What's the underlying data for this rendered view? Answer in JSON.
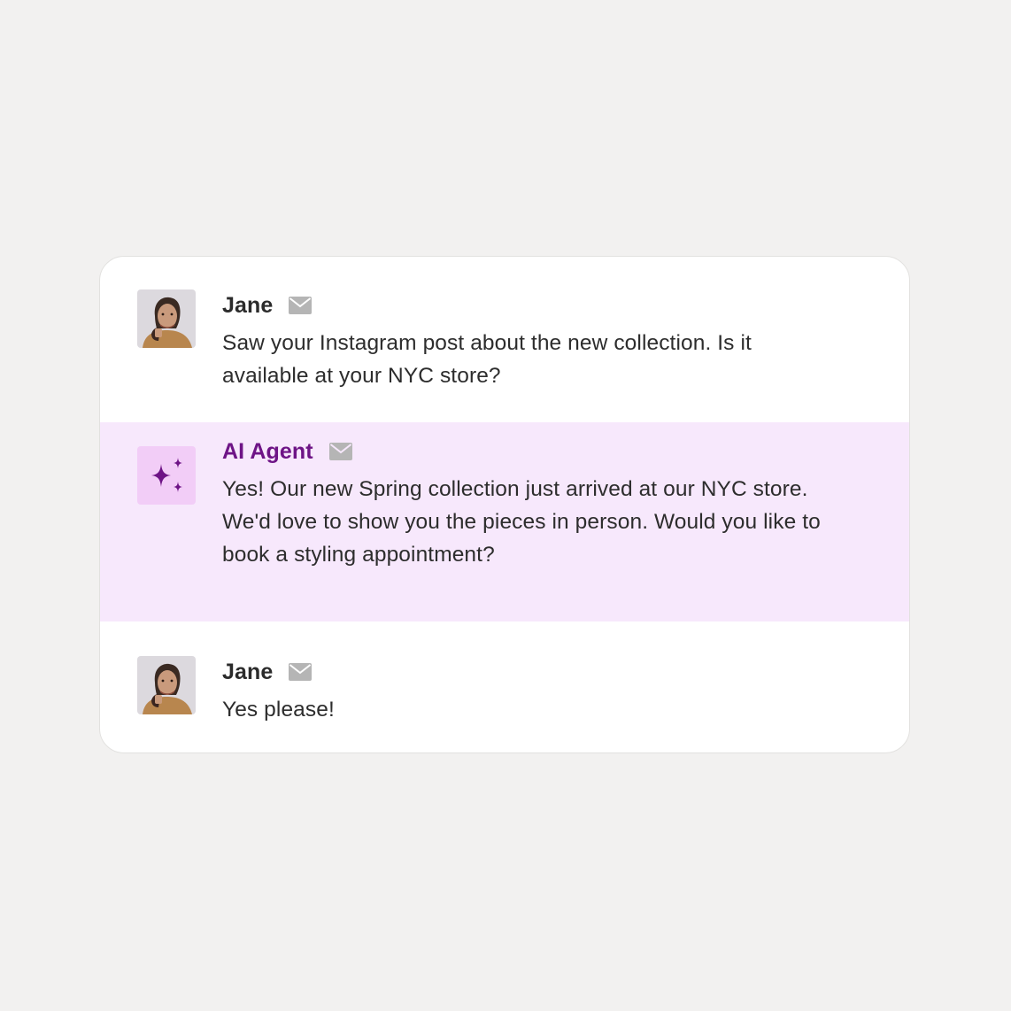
{
  "conversation": {
    "messages": [
      {
        "sender": "Jane",
        "avatar": "customer-photo",
        "channel_icon": "mail-icon",
        "text": "Saw your Instagram post about the new collection. Is it available at your NYC store?"
      },
      {
        "sender": "AI Agent",
        "avatar": "sparkles-icon",
        "channel_icon": "mail-icon",
        "text": "Yes! Our new Spring collection just arrived at our NYC store. We'd love to show you the pieces in person. Would you like to book a styling appointment?"
      },
      {
        "sender": "Jane",
        "avatar": "customer-photo",
        "channel_icon": "mail-icon",
        "text": "Yes please!"
      }
    ]
  },
  "colors": {
    "page_background": "#f2f1f0",
    "card_background": "#ffffff",
    "agent_row_background": "#f7e8fc",
    "agent_name": "#6e1486",
    "agent_icon_background": "#f2cdf7",
    "mail_icon": "#b5b5b5"
  }
}
